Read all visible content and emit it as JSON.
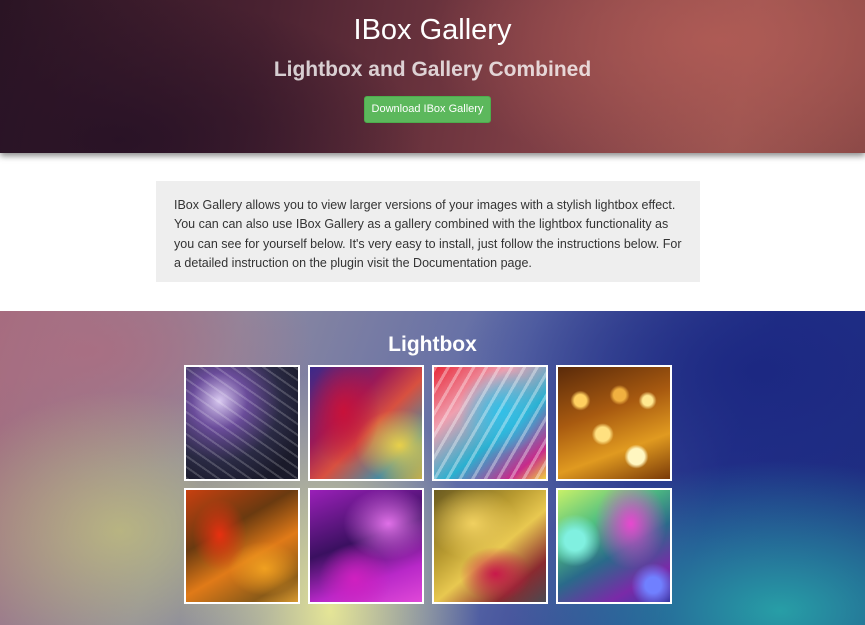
{
  "header": {
    "title": "IBox Gallery",
    "subtitle": "Lightbox and Gallery Combined",
    "download_label": "Download IBox Gallery"
  },
  "intro": {
    "text": "IBox Gallery allows you to view larger versions of your images with a stylish lightbox effect. You can can also use IBox Gallery as a gallery combined with the lightbox functionality as you can see for yourself below. It's very easy to install, just follow the instructions below. For a detailed instruction on the plugin visit the Documentation page."
  },
  "lightbox": {
    "heading": "Lightbox",
    "thumbnails": [
      {
        "name": "abstract-purple-swirls"
      },
      {
        "name": "blurred-rainbow"
      },
      {
        "name": "neon-paint-streaks"
      },
      {
        "name": "gold-bokeh"
      },
      {
        "name": "orange-texture"
      },
      {
        "name": "magenta-crystals"
      },
      {
        "name": "golden-liquid"
      },
      {
        "name": "colorful-bokeh"
      }
    ]
  },
  "colors": {
    "button_green": "#5cb85c",
    "intro_bg": "#eeeeee"
  }
}
